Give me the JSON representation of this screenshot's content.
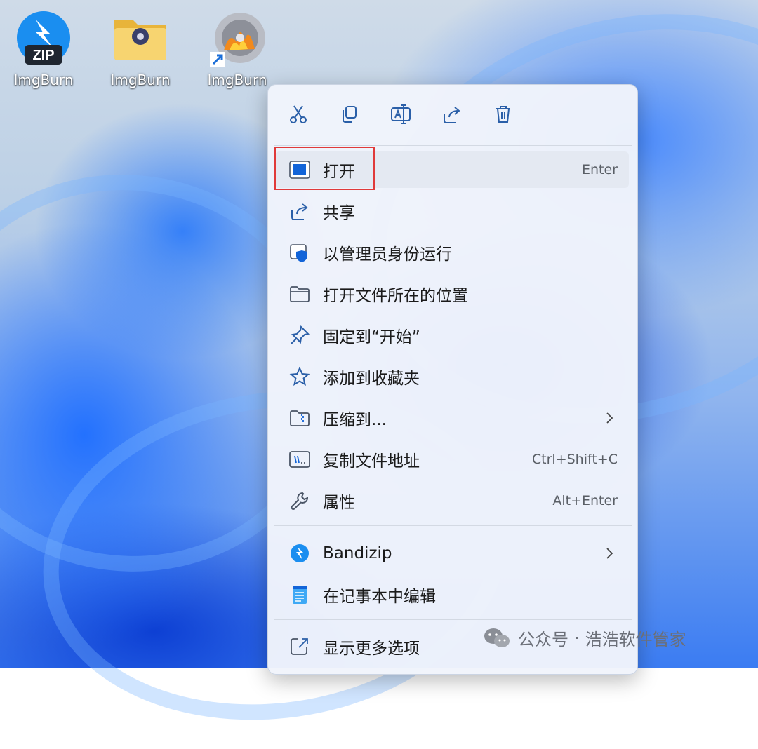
{
  "desktop": {
    "icons": [
      {
        "label": "ImgBurn",
        "kind": "zip"
      },
      {
        "label": "ImgBurn",
        "kind": "folder"
      },
      {
        "label": "ImgBurn",
        "kind": "disc-shortcut"
      }
    ],
    "zip_badge": "ZIP"
  },
  "context_menu": {
    "toolbar": [
      {
        "name": "cut-icon"
      },
      {
        "name": "copy-icon"
      },
      {
        "name": "rename-icon"
      },
      {
        "name": "share-icon"
      },
      {
        "name": "delete-icon"
      }
    ],
    "items": [
      {
        "label": "打开",
        "shortcut": "Enter",
        "icon": "open-icon"
      },
      {
        "label": "共享",
        "shortcut": "",
        "icon": "share-icon"
      },
      {
        "label": "以管理员身份运行",
        "shortcut": "",
        "icon": "run-as-admin-icon"
      },
      {
        "label": "打开文件所在的位置",
        "shortcut": "",
        "icon": "folder-icon"
      },
      {
        "label": "固定到“开始”",
        "shortcut": "",
        "icon": "pin-icon"
      },
      {
        "label": "添加到收藏夹",
        "shortcut": "",
        "icon": "star-icon"
      },
      {
        "label": "压缩到...",
        "shortcut": "",
        "icon": "compress-icon",
        "submenu": true
      },
      {
        "label": "复制文件地址",
        "shortcut": "Ctrl+Shift+C",
        "icon": "copy-path-icon"
      },
      {
        "label": "属性",
        "shortcut": "Alt+Enter",
        "icon": "wrench-icon"
      },
      {
        "label": "Bandizip",
        "shortcut": "",
        "icon": "bandizip-icon",
        "submenu": true
      },
      {
        "label": "在记事本中编辑",
        "shortcut": "",
        "icon": "notepad-icon"
      },
      {
        "label": "显示更多选项",
        "shortcut": "",
        "icon": "more-options-icon"
      }
    ]
  },
  "watermark": {
    "brand": "公众号",
    "dot": "·",
    "name": "浩浩软件管家"
  },
  "colors": {
    "accent": "#0a64d6",
    "highlight_border": "#e03a3a"
  }
}
